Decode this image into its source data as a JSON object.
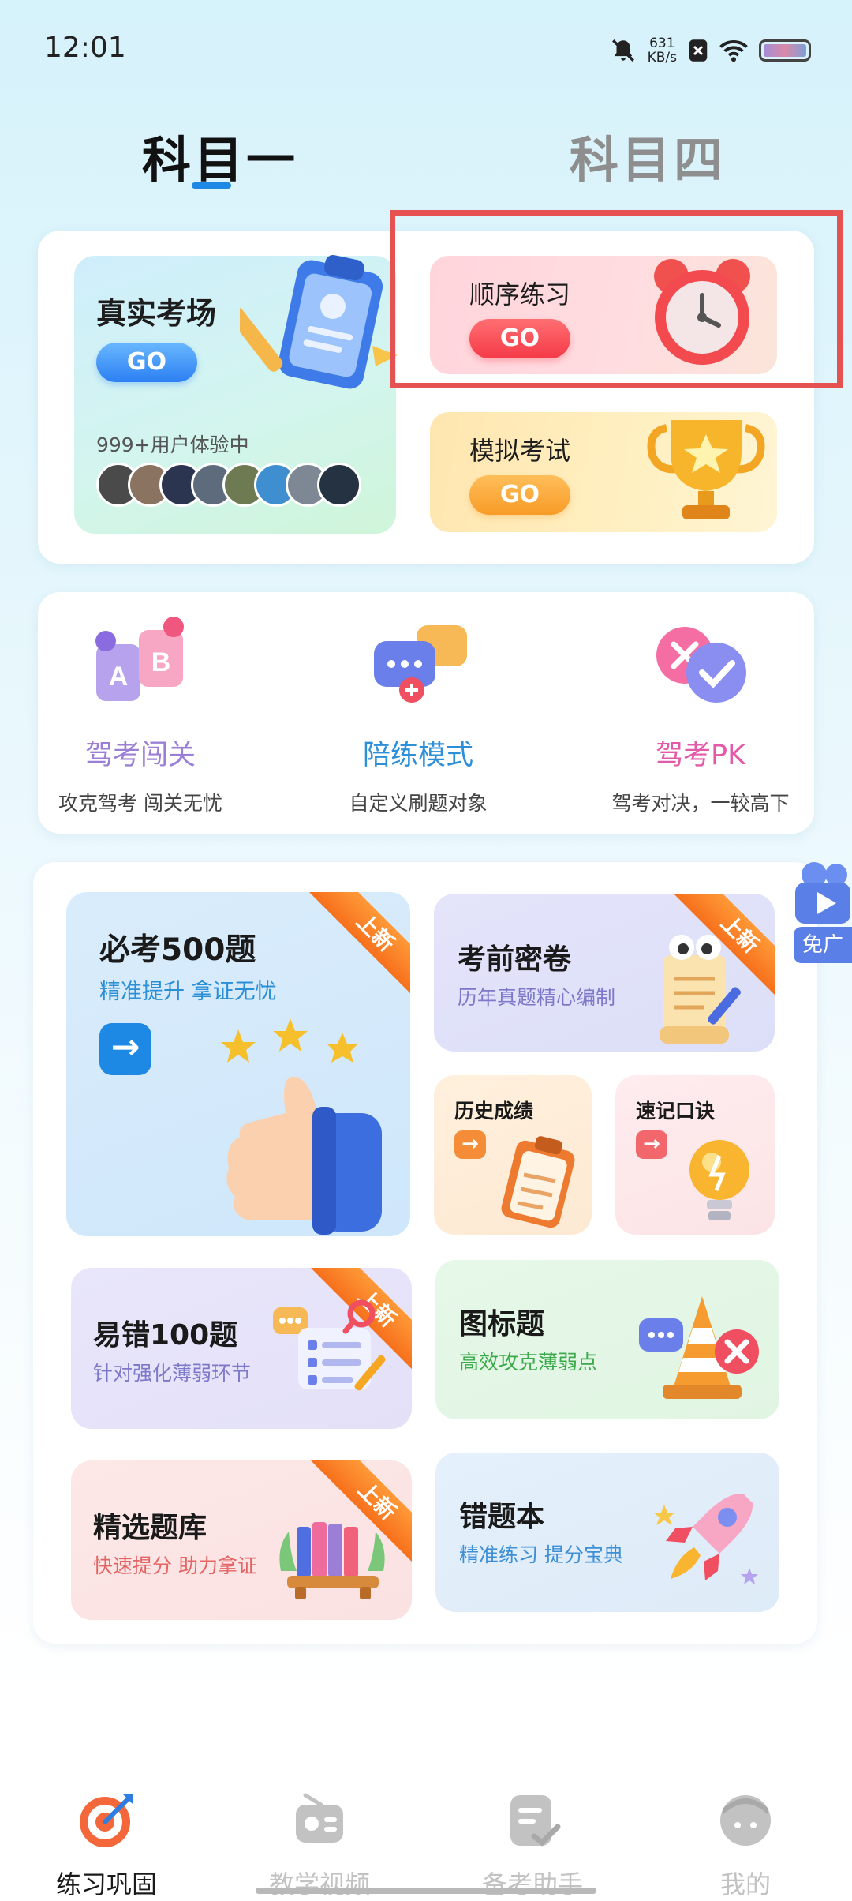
{
  "status_bar": {
    "time": "12:01",
    "speed_value": "631",
    "speed_unit": "KB/s"
  },
  "subject_tabs": [
    {
      "label": "科目一",
      "active": true
    },
    {
      "label": "科目四",
      "active": false
    }
  ],
  "top_card": {
    "real_exam": {
      "title": "真实考场",
      "go": "GO",
      "users_text": "999+用户体验中"
    },
    "sequential": {
      "title": "顺序练习",
      "go": "GO"
    },
    "mock_exam": {
      "title": "模拟考试",
      "go": "GO"
    }
  },
  "modes": [
    {
      "label": "驾考闯关",
      "sub": "攻克驾考 闯关无忧",
      "color": "#9b7fd6"
    },
    {
      "label": "陪练模式",
      "sub": "自定义刷题对象",
      "color": "#2d8fd8"
    },
    {
      "label": "驾考PK",
      "sub": "驾考对决，一较高下",
      "color": "#e35aa8"
    }
  ],
  "practice": {
    "must_500": {
      "title": "必考500题",
      "sub": "精准提升 拿证无忧",
      "ribbon": "上新"
    },
    "secret": {
      "title": "考前密卷",
      "sub": "历年真题精心编制",
      "ribbon": "上新"
    },
    "history": {
      "title": "历史成绩"
    },
    "mnemonic": {
      "title": "速记口诀"
    },
    "error_100": {
      "title": "易错100题",
      "sub": "针对强化薄弱环节",
      "ribbon": "上新"
    },
    "signs": {
      "title": "图标题",
      "sub": "高效攻克薄弱点"
    },
    "selected": {
      "title": "精选题库",
      "sub": "快速提分 助力拿证",
      "ribbon": "上新"
    },
    "wrong_book": {
      "title": "错题本",
      "sub": "精准练习 提分宝典"
    }
  },
  "float_ad": {
    "label": "免广"
  },
  "bottom_nav": [
    {
      "label": "练习巩固",
      "active": true
    },
    {
      "label": "教学视频",
      "active": false
    },
    {
      "label": "备考助手",
      "active": false
    },
    {
      "label": "我的",
      "active": false
    }
  ],
  "colors": {
    "accent_blue": "#1e88e5",
    "highlight_red": "#e65252",
    "ribbon_orange": "#f7701c"
  }
}
